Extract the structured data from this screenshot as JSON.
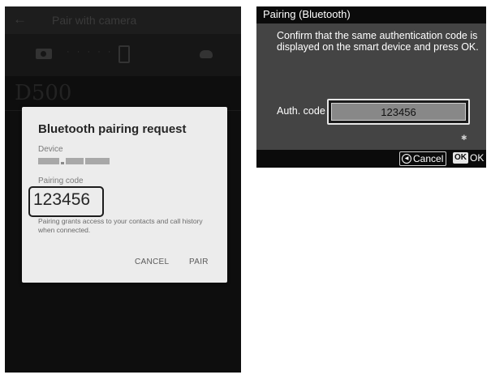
{
  "phone": {
    "header": {
      "back_icon": "back-arrow-icon",
      "title": "Pair with camera"
    },
    "pair_row": {
      "camera_icon": "camera-icon",
      "connector": "· · · · ·",
      "phone_icon": "smartphone-icon",
      "cloud_icon": "cloud-icon"
    },
    "camera_model": "D500",
    "dialog": {
      "title": "Bluetooth pairing request",
      "device_label": "Device",
      "device_name_obscured": true,
      "code_label": "Pairing code",
      "code": "123456",
      "note": "Pairing grants access to your contacts and call history when connected.",
      "cancel_label": "CANCEL",
      "pair_label": "PAIR"
    }
  },
  "camera": {
    "title": "Pairing (Bluetooth)",
    "message": "Confirm that the same authentication code is displayed on the smart device and press OK.",
    "auth_label": "Auth. code",
    "auth_code": "123456",
    "status_icon": "bluetooth-icon",
    "footer": {
      "cancel_icon": "multi-selector-icon",
      "cancel_label": "Cancel",
      "ok_badge": "OK",
      "ok_label": "OK"
    }
  }
}
